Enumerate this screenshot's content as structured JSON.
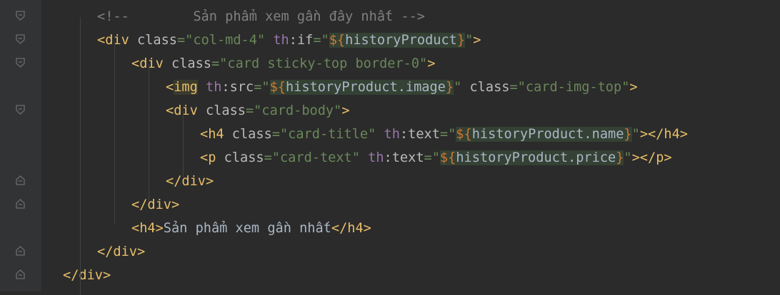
{
  "editor": {
    "lines": [
      {
        "indent": 1,
        "kind": "comment",
        "open": "<!--",
        "text": "Sản phẩm xem gần đây nhất",
        "close": "-->"
      },
      {
        "indent": 1,
        "kind": "div_if",
        "tag": "div",
        "attr1": "class",
        "val1": "col-md-4",
        "ns": "th",
        "attr2": "if",
        "expr": "historyProduct"
      },
      {
        "indent": 2,
        "kind": "div",
        "tag": "div",
        "attr1": "class",
        "val1": "card sticky-top border-0"
      },
      {
        "indent": 3,
        "kind": "img",
        "tag": "img",
        "ns": "th",
        "attr1": "src",
        "expr": "historyProduct.image",
        "attr2": "class",
        "val2": "card-img-top"
      },
      {
        "indent": 3,
        "kind": "div",
        "tag": "div",
        "attr1": "class",
        "val1": "card-body"
      },
      {
        "indent": 4,
        "kind": "text_tag",
        "tag": "h4",
        "attr1": "class",
        "val1": "card-title",
        "ns": "th",
        "attr2": "text",
        "expr": "historyProduct.name"
      },
      {
        "indent": 4,
        "kind": "text_tag",
        "tag": "p",
        "attr1": "class",
        "val1": "card-text",
        "ns": "th",
        "attr2": "text",
        "expr": "historyProduct.price"
      },
      {
        "indent": 3,
        "kind": "close",
        "tag": "div"
      },
      {
        "indent": 2,
        "kind": "close",
        "tag": "div"
      },
      {
        "indent": 2,
        "kind": "h4text",
        "tag": "h4",
        "text": "Sản phẩm xem gần nhất"
      },
      {
        "indent": 1,
        "kind": "close",
        "tag": "div"
      },
      {
        "indent": 0,
        "kind": "close",
        "tag": "div"
      }
    ]
  },
  "gutter": {
    "fold_markers": [
      "open",
      "open",
      "open",
      "none",
      "open",
      "none",
      "none",
      "close",
      "close",
      "none",
      "close",
      "close"
    ]
  },
  "colors": {
    "background": "#2b2b2b",
    "gutter": "#313335",
    "tag": "#e8bf6a",
    "attribute": "#bababa",
    "string": "#6a8759",
    "namespace": "#9876aa",
    "comment": "#808080",
    "expression_background": "#344134"
  }
}
